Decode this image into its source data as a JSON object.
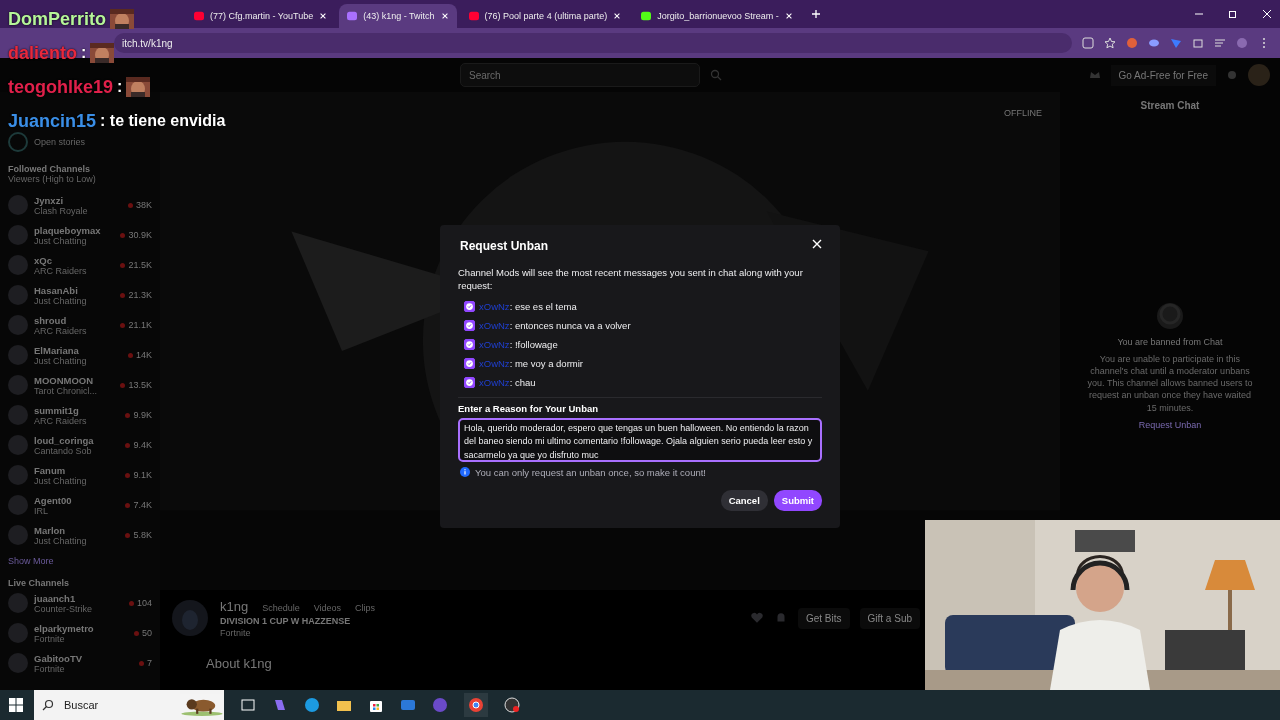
{
  "browser": {
    "tabs": [
      {
        "title": "(77) Cfg.martin - YouTube",
        "kind": "youtube",
        "selected": false
      },
      {
        "title": "(43) k1ng - Twitch",
        "kind": "twitch",
        "selected": true
      },
      {
        "title": "(76) Pool parte 4 (ultima parte)",
        "kind": "youtube",
        "selected": false
      },
      {
        "title": "Jorgito_barrionuevoo Stream -",
        "kind": "kick",
        "selected": false
      }
    ],
    "address": "itch.tv/k1ng"
  },
  "overlay_chat": [
    {
      "user": "DomPerrito",
      "color": "#b6f59a",
      "kind": "emote"
    },
    {
      "user": "daliento",
      "color": "#e8283c",
      "text": ":",
      "kind": "emote"
    },
    {
      "user": "teogohlke19",
      "color": "#e0204a",
      "text": ":",
      "kind": "emote"
    },
    {
      "user": "Juancin15",
      "color": "#3a8ee6",
      "text": ": te tiene envidia",
      "kind": "text"
    }
  ],
  "twitch_nav": {
    "search": {
      "placeholder": "Search"
    },
    "ad_free": "Go Ad-Free for Free"
  },
  "sidebar": {
    "stories": "Open stories",
    "followed_title": "Followed Channels",
    "sort": "Viewers (High to Low)",
    "followed": [
      {
        "name": "Jynxzi",
        "category": "Clash Royale",
        "viewers": "38K"
      },
      {
        "name": "plaqueboymax",
        "category": "Just Chatting",
        "viewers": "30.9K"
      },
      {
        "name": "xQc",
        "category": "ARC Raiders",
        "viewers": "21.5K"
      },
      {
        "name": "HasanAbi",
        "category": "Just Chatting",
        "viewers": "21.3K"
      },
      {
        "name": "shroud",
        "category": "ARC Raiders",
        "viewers": "21.1K"
      },
      {
        "name": "ElMariana",
        "category": "Just Chatting",
        "viewers": "14K"
      },
      {
        "name": "MOONMOON",
        "category": "Tarot Chronicl...",
        "viewers": "13.5K"
      },
      {
        "name": "summit1g",
        "category": "ARC Raiders",
        "viewers": "9.9K"
      },
      {
        "name": "loud_coringa",
        "category": "Cantando Sob",
        "viewers": "9.4K"
      },
      {
        "name": "Fanum",
        "category": "Just Chatting",
        "viewers": "9.1K"
      },
      {
        "name": "Agent00",
        "category": "IRL",
        "viewers": "7.4K"
      },
      {
        "name": "Marlon",
        "category": "Just Chatting",
        "viewers": "5.8K"
      }
    ],
    "show_more": "Show More",
    "live_title": "Live Channels",
    "live": [
      {
        "name": "juaanch1",
        "category": "Counter-Strike",
        "viewers": "104"
      },
      {
        "name": "elparkymetro",
        "category": "Fortnite",
        "viewers": "50"
      },
      {
        "name": "GabitooTV",
        "category": "Fortnite",
        "viewers": "7"
      }
    ]
  },
  "video": {
    "status": "OFFLINE"
  },
  "channel": {
    "name": "k1ng",
    "links": [
      "Schedule",
      "Videos",
      "Clips"
    ],
    "title": "DIVISION 1 CUP W HAZZENSE",
    "category": "Fortnite",
    "about": "About k1ng",
    "actions": [
      "Get Bits",
      "Gift a Sub"
    ]
  },
  "chat": {
    "title": "Stream Chat",
    "banned_title": "You are banned from Chat",
    "banned_text": "You are unable to participate in this channel's chat until a moderator unbans you. This channel allows banned users to request an unban once they have waited 15 minutes.",
    "link": "Request Unban"
  },
  "modal": {
    "title": "Request Unban",
    "intro": "Channel Mods will see the most recent messages you sent in chat along with your request:",
    "messages": [
      {
        "user": "xOwNz",
        "text": ": ese es el tema",
        "checked": true
      },
      {
        "user": "xOwNz",
        "text": ": entonces nunca va a volver",
        "checked": true
      },
      {
        "user": "xOwNz",
        "text": ": !followage",
        "checked": true
      },
      {
        "user": "xOwNz",
        "text": ": me voy a dormir",
        "checked": true
      },
      {
        "user": "xOwNz",
        "text": ": chau",
        "checked": true
      }
    ],
    "reason_label": "Enter a Reason for Your Unban",
    "reason": "Hola, querido moderador, espero que tengas un buen halloween. No entiendo la razon del baneo siendo mi ultimo comentario !followage. Ojala alguien serio pueda leer esto y sacarmelo ya que yo disfruto muc",
    "note": "You can only request an unban once, so make it count!",
    "cancel": "Cancel",
    "submit": "Submit"
  },
  "taskbar": {
    "search": {
      "placeholder": "Buscar"
    }
  }
}
